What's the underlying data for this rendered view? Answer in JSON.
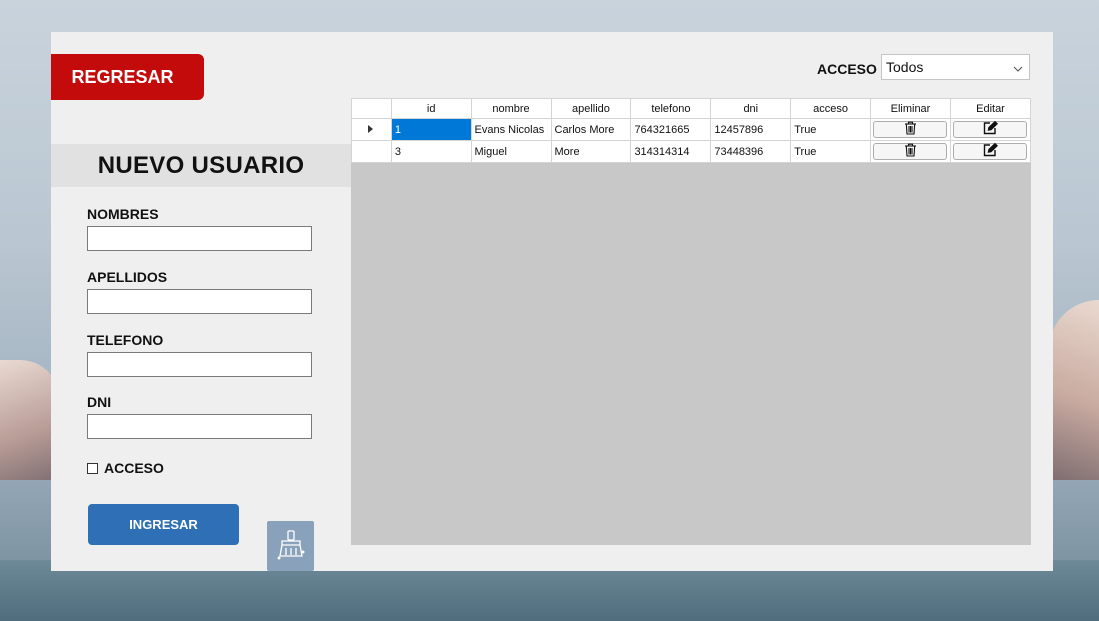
{
  "header": {
    "back_label": "REGRESAR",
    "filter_label": "ACCESO",
    "filter_value": "Todos"
  },
  "form": {
    "title": "NUEVO USUARIO",
    "nombres_label": "NOMBRES",
    "nombres_value": "",
    "apellidos_label": "APELLIDOS",
    "apellidos_value": "",
    "telefono_label": "TELEFONO",
    "telefono_value": "",
    "dni_label": "DNI",
    "dni_value": "",
    "acceso_label": "ACCESO",
    "acceso_checked": false,
    "submit_label": "INGRESAR",
    "clear_icon": "broom-icon"
  },
  "grid": {
    "columns": [
      "id",
      "nombre",
      "apellido",
      "telefono",
      "dni",
      "acceso",
      "Eliminar",
      "Editar"
    ],
    "rows": [
      {
        "id": "1",
        "nombre": "Evans Nicolas",
        "apellido": "Carlos More",
        "telefono": "764321665",
        "dni": "12457896",
        "acceso": "True",
        "selected": true
      },
      {
        "id": "3",
        "nombre": "Miguel",
        "apellido": "More",
        "telefono": "314314314",
        "dni": "73448396",
        "acceso": "True",
        "selected": false
      }
    ],
    "delete_icon": "trash-icon",
    "edit_icon": "edit-icon"
  },
  "colors": {
    "back_button": "#c40b0b",
    "submit_button": "#2e6fb5",
    "clear_button": "#8aa1bb",
    "selection": "#0078d7"
  }
}
